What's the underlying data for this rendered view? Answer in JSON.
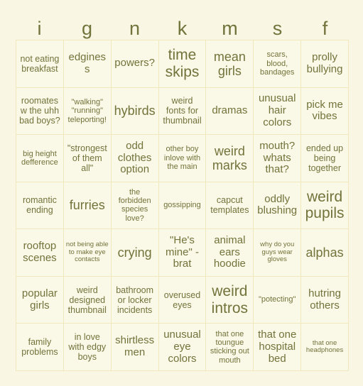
{
  "board": {
    "columns": [
      "i",
      "g",
      "n",
      "k",
      "m",
      "s",
      "f"
    ],
    "colors": {
      "page_background": "#f9f7e4",
      "cell_background": "#faf8e6",
      "grid_line": "#f0e8bc",
      "text": "#73733c"
    },
    "rows": [
      [
        {
          "text": "not eating breakfast",
          "size": "sm"
        },
        {
          "text": "edginess",
          "size": "md"
        },
        {
          "text": "powers?",
          "size": "md"
        },
        {
          "text": "time skips",
          "size": "xl"
        },
        {
          "text": "mean girls",
          "size": "lg"
        },
        {
          "text": "scars, blood, bandages",
          "size": "xs"
        },
        {
          "text": "prolly bullying",
          "size": "md"
        }
      ],
      [
        {
          "text": "roomates w the uhh bad boys?",
          "size": "sm"
        },
        {
          "text": "\"walking\" \"running\" teleporting!",
          "size": "xs"
        },
        {
          "text": "hybirds",
          "size": "lg"
        },
        {
          "text": "weird fonts for thumbnail",
          "size": "sm"
        },
        {
          "text": "dramas",
          "size": "md"
        },
        {
          "text": "unusual hair colors",
          "size": "md"
        },
        {
          "text": "pick me vibes",
          "size": "md"
        }
      ],
      [
        {
          "text": "big height defference",
          "size": "xs"
        },
        {
          "text": "\"strongest of them all\"",
          "size": "sm"
        },
        {
          "text": "odd clothes option",
          "size": "md"
        },
        {
          "text": "other boy inlove with the main",
          "size": "xs"
        },
        {
          "text": "weird marks",
          "size": "lg"
        },
        {
          "text": "mouth? whats that?",
          "size": "md"
        },
        {
          "text": "ended up being together",
          "size": "sm"
        }
      ],
      [
        {
          "text": "romantic ending",
          "size": "sm"
        },
        {
          "text": "furries",
          "size": "lg"
        },
        {
          "text": "the forbidden species love?",
          "size": "xs"
        },
        {
          "text": "gossipping",
          "size": "xs"
        },
        {
          "text": "capcut templates",
          "size": "sm"
        },
        {
          "text": "oddly blushing",
          "size": "md"
        },
        {
          "text": "weird pupils",
          "size": "xl"
        }
      ],
      [
        {
          "text": "rooftop scenes",
          "size": "md"
        },
        {
          "text": "not being able to make eye contacts",
          "size": "xxs"
        },
        {
          "text": "crying",
          "size": "lg"
        },
        {
          "text": "\"He's mine\" -brat",
          "size": "md"
        },
        {
          "text": "animal ears hoodie",
          "size": "md"
        },
        {
          "text": "why do you guys wear gloves",
          "size": "xxs"
        },
        {
          "text": "alphas",
          "size": "lg"
        }
      ],
      [
        {
          "text": "popular girls",
          "size": "md"
        },
        {
          "text": "weird designed thumbnail",
          "size": "sm"
        },
        {
          "text": "bathroom or locker incidents",
          "size": "sm"
        },
        {
          "text": "overused eyes",
          "size": "sm"
        },
        {
          "text": "weird intros",
          "size": "xl"
        },
        {
          "text": "\"potecting\"",
          "size": "xs"
        },
        {
          "text": "hutring others",
          "size": "md"
        }
      ],
      [
        {
          "text": "family problems",
          "size": "sm"
        },
        {
          "text": "in love with edgy boys",
          "size": "sm"
        },
        {
          "text": "shirtless men",
          "size": "md"
        },
        {
          "text": "unusual eye colors",
          "size": "md"
        },
        {
          "text": "that one toungue sticking out mouth",
          "size": "xs"
        },
        {
          "text": "that one hospital bed",
          "size": "md"
        },
        {
          "text": "that one headphones",
          "size": "xxs"
        }
      ]
    ]
  }
}
